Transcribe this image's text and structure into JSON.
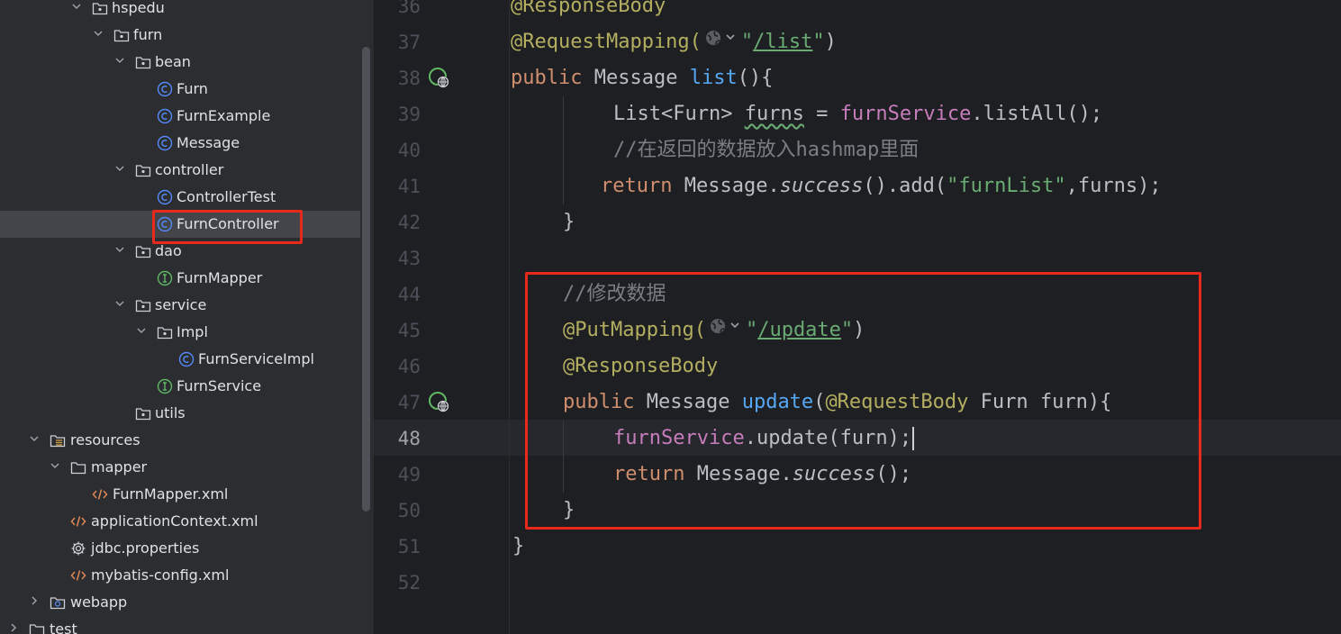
{
  "project_tree": {
    "items": [
      {
        "label": "hspedu",
        "type": "package",
        "depth": 0,
        "expanded": true
      },
      {
        "label": "furn",
        "type": "package",
        "depth": 1,
        "expanded": true
      },
      {
        "label": "bean",
        "type": "package",
        "depth": 2,
        "expanded": true
      },
      {
        "label": "Furn",
        "type": "class",
        "depth": 3
      },
      {
        "label": "FurnExample",
        "type": "class",
        "depth": 3
      },
      {
        "label": "Message",
        "type": "class",
        "depth": 3
      },
      {
        "label": "controller",
        "type": "package",
        "depth": 2,
        "expanded": true
      },
      {
        "label": "ControllerTest",
        "type": "class",
        "depth": 3
      },
      {
        "label": "FurnController",
        "type": "class",
        "depth": 3,
        "selected": true
      },
      {
        "label": "dao",
        "type": "package",
        "depth": 2,
        "expanded": true
      },
      {
        "label": "FurnMapper",
        "type": "interface",
        "depth": 3
      },
      {
        "label": "service",
        "type": "package",
        "depth": 2,
        "expanded": true
      },
      {
        "label": "Impl",
        "type": "package",
        "depth": 3,
        "expanded": true
      },
      {
        "label": "FurnServiceImpl",
        "type": "class",
        "depth": 4
      },
      {
        "label": "FurnService",
        "type": "interface",
        "depth": 3
      },
      {
        "label": "utils",
        "type": "package",
        "depth": 2
      },
      {
        "label": "resources",
        "type": "resources",
        "depth": -1,
        "expanded": true
      },
      {
        "label": "mapper",
        "type": "folder",
        "depth": 0,
        "expanded": true
      },
      {
        "label": "FurnMapper.xml",
        "type": "xml",
        "depth": 1
      },
      {
        "label": "applicationContext.xml",
        "type": "xml",
        "depth": 0
      },
      {
        "label": "jdbc.properties",
        "type": "properties",
        "depth": 0
      },
      {
        "label": "mybatis-config.xml",
        "type": "xml",
        "depth": 0
      },
      {
        "label": "webapp",
        "type": "package",
        "depth": -1,
        "expanded": false
      },
      {
        "label": "test",
        "type": "folder",
        "depth": -2,
        "expanded": false
      }
    ]
  },
  "editor": {
    "current_line": 48,
    "line_numbers": [
      "36",
      "37",
      "38",
      "39",
      "40",
      "41",
      "42",
      "43",
      "44",
      "45",
      "46",
      "47",
      "48",
      "49",
      "50",
      "51",
      "52"
    ],
    "lines": {
      "l36": {
        "anno": "@ResponseBody"
      },
      "l37": {
        "anno": "@RequestMapping(",
        "path": "/list",
        "close": ")"
      },
      "l38": {
        "kw": "public",
        "type": " Message ",
        "fn": "list",
        "rest": "(){"
      },
      "l39": {
        "a": "List<Furn> ",
        "var": "furns",
        "b": " = ",
        "field": "furnService",
        "c": ".listAll();"
      },
      "l40": {
        "comment": "//在返回的数据放入hashmap里面"
      },
      "l41": {
        "kw": "return",
        "a": " Message.",
        "it": "success",
        "b": "().add(",
        "str": "\"furnList\"",
        "c": ",furns);"
      },
      "l42": {
        "text": "}"
      },
      "l44": {
        "comment": "//修改数据"
      },
      "l45": {
        "anno": "@PutMapping(",
        "path": "/update",
        "close": ")"
      },
      "l46": {
        "anno": "@ResponseBody"
      },
      "l47": {
        "kw": "public",
        "type": " Message ",
        "fn": "update",
        "a": "(",
        "anno": "@RequestBody",
        "b": " Furn furn){"
      },
      "l48": {
        "field": "furnService",
        "a": ".update(furn);"
      },
      "l49": {
        "kw": "return",
        "a": " Message.",
        "it": "success",
        "b": "();"
      },
      "l50": {
        "text": "}"
      },
      "l51": {
        "text": "}"
      }
    }
  },
  "colors": {
    "highlight_box": "#e8291c",
    "annotation": "#b3ae60",
    "keyword": "#cf8e6d",
    "method": "#56a8f5",
    "string": "#6aab73",
    "field": "#c77dbb",
    "comment": "#7a7e85"
  }
}
